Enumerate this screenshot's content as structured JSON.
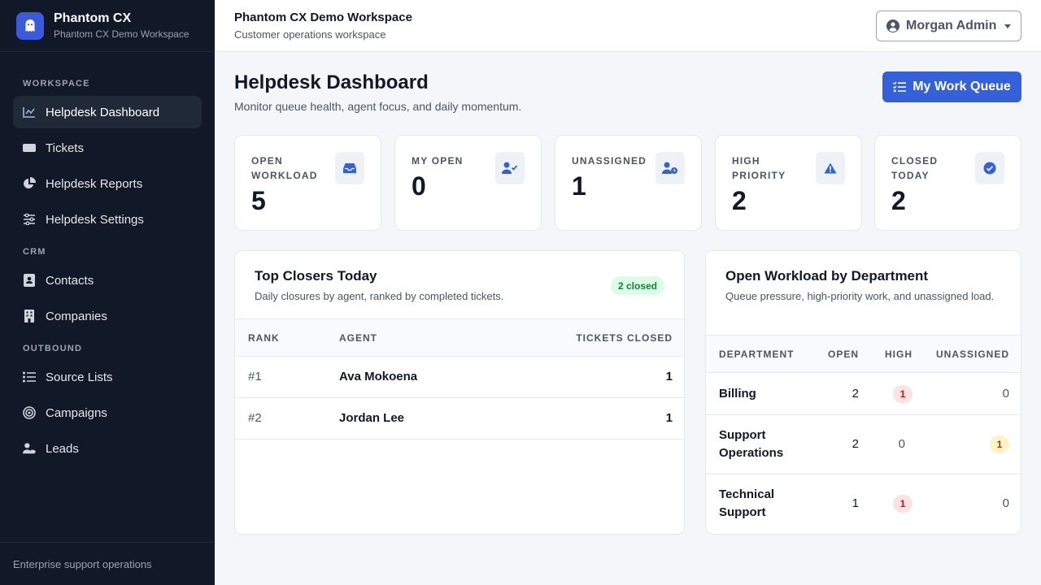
{
  "brand": {
    "title": "Phantom CX",
    "subtitle": "Phantom CX Demo Workspace"
  },
  "sidebar": {
    "sections": [
      {
        "label": "WORKSPACE",
        "items": [
          {
            "label": "Helpdesk Dashboard",
            "icon": "chart-line-icon",
            "active": true
          },
          {
            "label": "Tickets",
            "icon": "ticket-icon"
          },
          {
            "label": "Helpdesk Reports",
            "icon": "pie-chart-icon"
          },
          {
            "label": "Helpdesk Settings",
            "icon": "sliders-icon"
          }
        ]
      },
      {
        "label": "CRM",
        "items": [
          {
            "label": "Contacts",
            "icon": "address-card-icon"
          },
          {
            "label": "Companies",
            "icon": "building-icon"
          }
        ]
      },
      {
        "label": "OUTBOUND",
        "items": [
          {
            "label": "Source Lists",
            "icon": "list-icon"
          },
          {
            "label": "Campaigns",
            "icon": "target-icon"
          },
          {
            "label": "Leads",
            "icon": "user-tag-icon"
          }
        ]
      }
    ],
    "footer": "Enterprise support operations"
  },
  "topbar": {
    "title": "Phantom CX Demo Workspace",
    "subtitle": "Customer operations workspace",
    "user": "Morgan Admin"
  },
  "page": {
    "title": "Helpdesk Dashboard",
    "subtitle": "Monitor queue health, agent focus, and daily momentum.",
    "queue_button": "My Work Queue"
  },
  "stats": [
    {
      "label": "OPEN WORKLOAD",
      "value": "5",
      "icon": "inbox-icon"
    },
    {
      "label": "MY OPEN",
      "value": "0",
      "icon": "user-check-icon"
    },
    {
      "label": "UNASSIGNED",
      "value": "1",
      "icon": "user-clock-icon"
    },
    {
      "label": "HIGH PRIORITY",
      "value": "2",
      "icon": "warning-icon"
    },
    {
      "label": "CLOSED TODAY",
      "value": "2",
      "icon": "check-circle-icon"
    }
  ],
  "closers": {
    "title": "Top Closers Today",
    "subtitle": "Daily closures by agent, ranked by completed tickets.",
    "badge": "2 closed",
    "headers": [
      "RANK",
      "AGENT",
      "TICKETS CLOSED"
    ],
    "rows": [
      {
        "rank": "#1",
        "agent": "Ava Mokoena",
        "closed": "1"
      },
      {
        "rank": "#2",
        "agent": "Jordan Lee",
        "closed": "1"
      }
    ]
  },
  "workload": {
    "title": "Open Workload by Department",
    "subtitle": "Queue pressure, high-priority work, and unassigned load.",
    "headers": [
      "DEPARTMENT",
      "OPEN",
      "HIGH",
      "UNASSIGNED"
    ],
    "rows": [
      {
        "dept": "Billing",
        "open": "2",
        "high": "1",
        "unassigned": "0"
      },
      {
        "dept": "Support Operations",
        "open": "2",
        "high": "0",
        "unassigned": "1"
      },
      {
        "dept": "Technical Support",
        "open": "1",
        "high": "1",
        "unassigned": "0"
      }
    ]
  },
  "colors": {
    "sidebar_bg": "#111827",
    "accent": "#3461d9",
    "danger_pill": "#fee2e2",
    "warning_pill": "#fef3c7",
    "success_badge": "#dcfce7"
  }
}
